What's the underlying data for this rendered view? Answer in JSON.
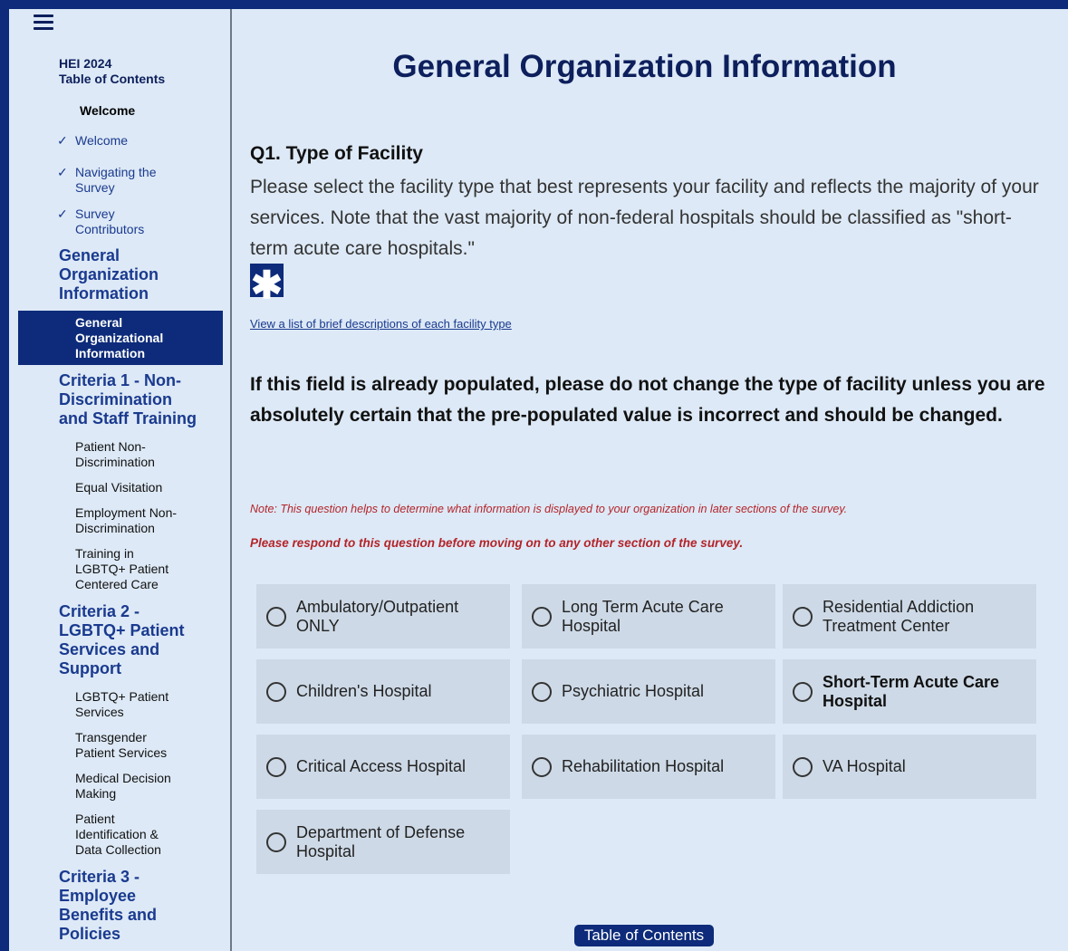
{
  "colors": {
    "accent": "#0d2b7a",
    "background": "#dde9f6",
    "note_red": "#b3242a",
    "option_bg": "#cdd9e6"
  },
  "sidebar": {
    "menu_icon": "hamburger-menu-icon",
    "toc_title_line1": "HEI 2024",
    "toc_title_line2": "Table of Contents",
    "welcome_head": "Welcome",
    "checked_items": [
      {
        "check": "✓",
        "label": "Welcome"
      },
      {
        "check": "✓",
        "label_line1": "Navigating the",
        "label_line2": "Survey"
      },
      {
        "check": "✓",
        "label_line1": "Survey",
        "label_line2": "Contributors"
      }
    ],
    "general": {
      "line1": "General",
      "line2": "Organization",
      "line3": "Information"
    },
    "active_item": {
      "line1": "General",
      "line2": "Organizational",
      "line3": "Information"
    },
    "criteria1": {
      "line1": "Criteria 1 - Non-",
      "line2": "Discrimination",
      "line3": "and Staff Training",
      "items": [
        {
          "line1": "Patient Non-",
          "line2": "Discrimination"
        },
        {
          "line1": "Equal Visitation"
        },
        {
          "line1": "Employment Non-",
          "line2": "Discrimination"
        },
        {
          "line1": "Training in",
          "line2": "LGBTQ+ Patient",
          "line3": "Centered Care"
        }
      ]
    },
    "criteria2": {
      "line1": "Criteria 2 -",
      "line2": "LGBTQ+ Patient",
      "line3": "Services and",
      "line4": "Support",
      "items": [
        {
          "line1": "LGBTQ+ Patient",
          "line2": "Services"
        },
        {
          "line1": "Transgender",
          "line2": "Patient Services"
        },
        {
          "line1": "Medical Decision",
          "line2": "Making"
        },
        {
          "line1": "Patient",
          "line2": "Identification &",
          "line3": "Data Collection"
        }
      ]
    },
    "criteria3": {
      "line1": "Criteria 3 -",
      "line2": "Employee",
      "line3": "Benefits and",
      "line4": "Policies"
    }
  },
  "main": {
    "page_title": "General Organization Information",
    "question_title": "Q1. Type of Facility",
    "question_desc": "Please select the facility type that best represents your facility and reflects the majority of your services. Note that the vast majority of non-federal hospitals should be classified as \"short-term acute care hospitals.\"",
    "required_symbol": "✱",
    "required_icon": "asterisk-required-icon",
    "description_link": "View a list of brief descriptions of each facility type",
    "warning": "If this field is already populated, please do not change the type of facility unless you are absolutely certain that the pre-populated value is incorrect and should be changed.",
    "note": "Note: This question helps to determine what information is displayed to your organization in later sections of the survey.",
    "note2": "Please respond to this question before moving on to any other section of the survey.",
    "options": [
      {
        "label": "Ambulatory/Outpatient ONLY",
        "selected": false
      },
      {
        "label": "Long Term Acute Care Hospital",
        "selected": false
      },
      {
        "label": "Residential Addiction Treatment Center",
        "selected": false
      },
      {
        "label": "Children's Hospital",
        "selected": false
      },
      {
        "label": "Psychiatric Hospital",
        "selected": false
      },
      {
        "label": "Short-Term Acute Care Hospital",
        "selected": false
      },
      {
        "label": "Critical Access Hospital",
        "selected": false
      },
      {
        "label": "Rehabilitation Hospital",
        "selected": false
      },
      {
        "label": "VA Hospital",
        "selected": false
      },
      {
        "label": "Department of Defense Hospital",
        "selected": false
      }
    ],
    "toc_button": "Table of Contents"
  }
}
